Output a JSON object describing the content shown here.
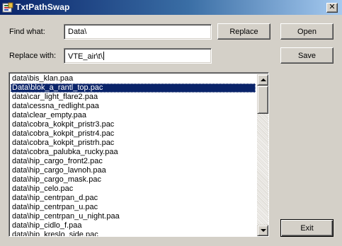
{
  "window": {
    "title": "TxtPathSwap",
    "close_glyph": "✕",
    "icon": "app-icon"
  },
  "colors": {
    "titlebar_start": "#0a246a",
    "titlebar_end": "#a6caf0",
    "face": "#d4d0c8",
    "selection": "#0a246a"
  },
  "form": {
    "find_label": "Find what:",
    "find_value": "Data\\",
    "replace_label": "Replace with:",
    "replace_value": "VTE_air\\t\\"
  },
  "buttons": {
    "replace": "Replace",
    "open": "Open",
    "save": "Save",
    "exit": "Exit"
  },
  "list": {
    "selected_index": 1,
    "items": [
      "data\\bis_klan.paa",
      "Data\\blok_a_rantl_top.pac",
      "data\\car_light_flare2.paa",
      "data\\cessna_redlight.paa",
      "data\\clear_empty.paa",
      "data\\cobra_kokpit_pristr3.pac",
      "data\\cobra_kokpit_pristr4.pac",
      "data\\cobra_kokpit_pristrh.pac",
      "data\\cobra_palubka_rucky.paa",
      "data\\hip_cargo_front2.pac",
      "data\\hip_cargo_lavnoh.paa",
      "data\\hip_cargo_mask.pac",
      "data\\hip_celo.pac",
      "data\\hip_centrpan_d.pac",
      "data\\hip_centrpan_u.pac",
      "data\\hip_centrpan_u_night.paa",
      "data\\hip_cidlo_f.paa",
      "data\\hip_kreslo_side.pac"
    ]
  }
}
